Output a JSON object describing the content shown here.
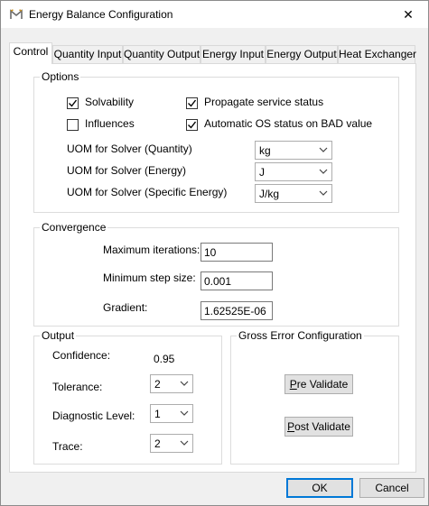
{
  "window": {
    "title": "Energy Balance Configuration",
    "close_glyph": "✕",
    "icon": "app-m-icon"
  },
  "tabs": [
    {
      "label": "Control"
    },
    {
      "label": "Quantity Input"
    },
    {
      "label": "Quantity Output"
    },
    {
      "label": "Energy Input"
    },
    {
      "label": "Energy Output"
    },
    {
      "label": "Heat Exchanger"
    }
  ],
  "options": {
    "legend": "Options",
    "solvability": {
      "label": "Solvability",
      "checked": true
    },
    "influences": {
      "label": "Influences",
      "checked": false
    },
    "propagate": {
      "label": "Propagate service status",
      "checked": true
    },
    "automatic_os": {
      "label": "Automatic OS status on BAD value",
      "checked": true
    },
    "uom_quantity": {
      "label": "UOM for Solver (Quantity)",
      "value": "kg"
    },
    "uom_energy": {
      "label": "UOM for Solver (Energy)",
      "value": "J"
    },
    "uom_specific": {
      "label": "UOM for Solver (Specific Energy)",
      "value": "J/kg"
    }
  },
  "convergence": {
    "legend": "Convergence",
    "max_iter": {
      "label": "Maximum iterations:",
      "value": "10"
    },
    "min_step": {
      "label": "Minimum step size:",
      "value": "0.001"
    },
    "gradient": {
      "label": "Gradient:",
      "value": "1.62525E-06"
    }
  },
  "output": {
    "legend": "Output",
    "confidence": {
      "label": "Confidence:",
      "value": "0.95"
    },
    "tolerance": {
      "label": "Tolerance:",
      "value": "2"
    },
    "diagnostic": {
      "label": "Diagnostic Level:",
      "value": "1"
    },
    "trace": {
      "label": "Trace:",
      "value": "2"
    }
  },
  "gross_error": {
    "legend": "Gross Error Configuration",
    "pre_validate": {
      "mnemonic": "P",
      "rest": "re Validate"
    },
    "post_validate": {
      "mnemonic": "P",
      "rest": "ost Validate"
    }
  },
  "footer": {
    "ok": "OK",
    "cancel": "Cancel"
  },
  "colors": {
    "accent": "#0078d7",
    "check": "#000000"
  }
}
